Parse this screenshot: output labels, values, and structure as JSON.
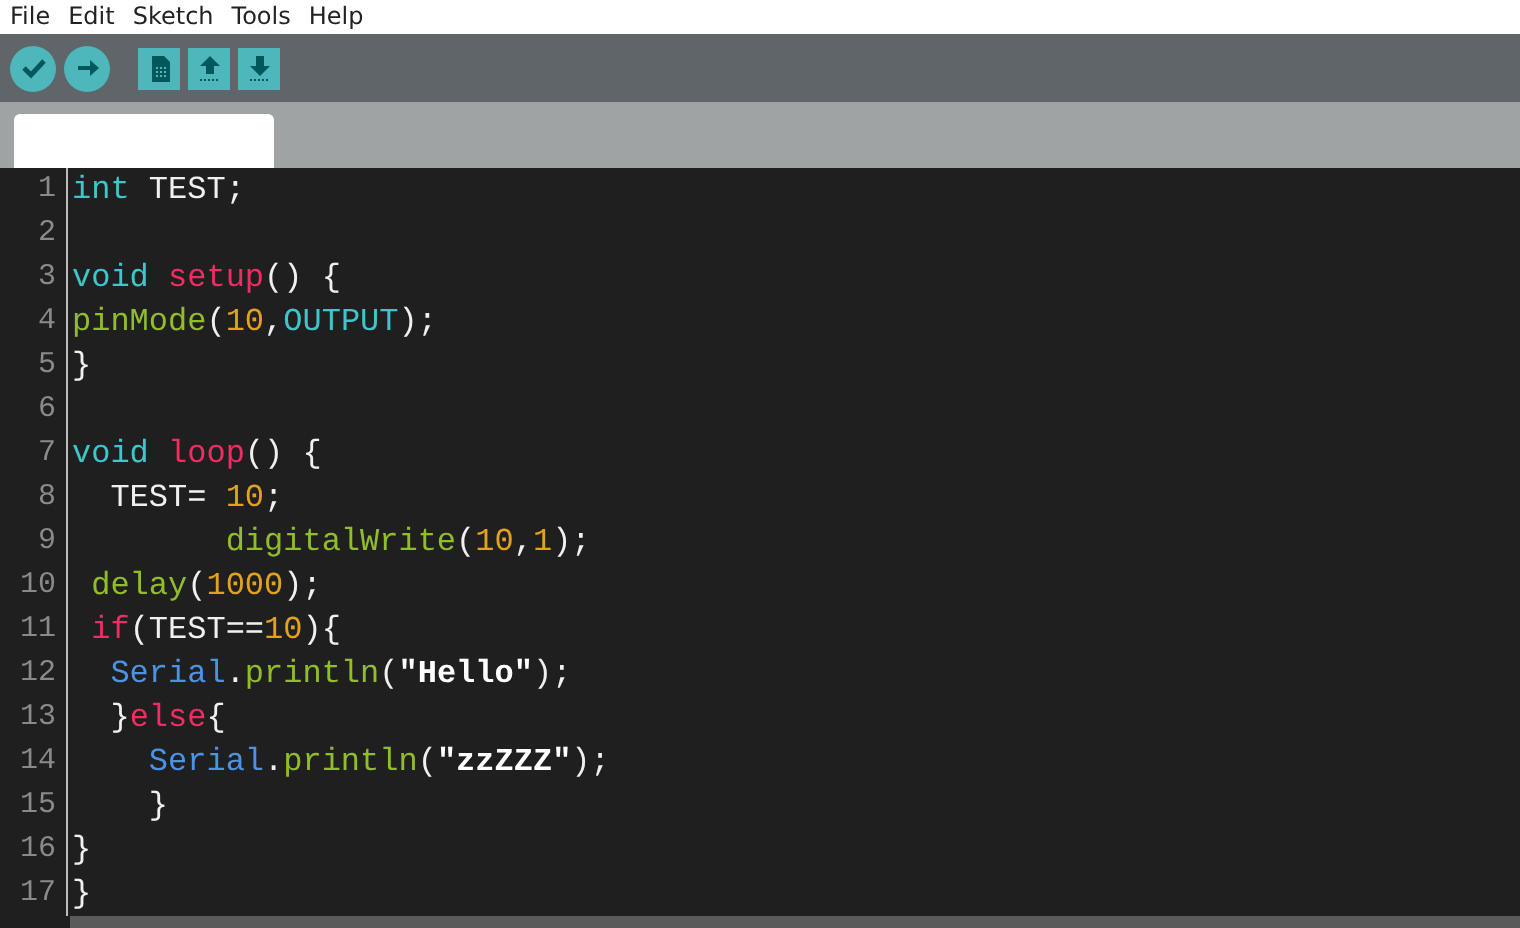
{
  "menu": [
    "File",
    "Edit",
    "Sketch",
    "Tools",
    "Help"
  ],
  "toolbar": [
    {
      "kind": "verify"
    },
    {
      "kind": "upload"
    },
    {
      "kind": "new"
    },
    {
      "kind": "open"
    },
    {
      "kind": "save"
    }
  ],
  "tabs": [
    {
      "selected": true
    }
  ],
  "editor": {
    "lines": [
      {
        "number": "1",
        "tokens": [
          {
            "kind": "type",
            "text": "int"
          },
          {
            "kind": "plain",
            "text": " TEST;"
          }
        ]
      },
      {
        "number": "2"
      },
      {
        "number": "3",
        "tokens": [
          {
            "kind": "type",
            "text": "void "
          },
          {
            "kind": "control",
            "text": "setup"
          },
          {
            "kind": "plain",
            "text": "() {"
          }
        ]
      },
      {
        "number": "4",
        "tokens": [
          {
            "kind": "function",
            "text": "pinMode"
          },
          {
            "kind": "plain",
            "text": "("
          },
          {
            "kind": "number",
            "text": "10"
          },
          {
            "kind": "plain",
            "text": ","
          },
          {
            "kind": "constant",
            "text": "OUTPUT"
          },
          {
            "kind": "plain",
            "text": ");"
          }
        ]
      },
      {
        "number": "5",
        "tokens": [
          {
            "kind": "plain",
            "text": "}"
          }
        ]
      },
      {
        "number": "6"
      },
      {
        "number": "7",
        "tokens": [
          {
            "kind": "type",
            "text": "void "
          },
          {
            "kind": "control",
            "text": "loop"
          },
          {
            "kind": "plain",
            "text": "() {"
          }
        ]
      },
      {
        "number": "8",
        "tokens": [
          {
            "kind": "plain",
            "text": "  TEST= "
          },
          {
            "kind": "number",
            "text": "10"
          },
          {
            "kind": "plain",
            "text": ";"
          }
        ]
      },
      {
        "number": "9",
        "tokens": [
          {
            "kind": "function",
            "text": "        digitalWrite"
          },
          {
            "kind": "plain",
            "text": "("
          },
          {
            "kind": "number",
            "text": "10"
          },
          {
            "kind": "plain",
            "text": ","
          },
          {
            "kind": "number",
            "text": "1"
          },
          {
            "kind": "plain",
            "text": ");"
          }
        ]
      },
      {
        "number": "10",
        "tokens": [
          {
            "kind": "function",
            "text": " delay"
          },
          {
            "kind": "plain",
            "text": "("
          },
          {
            "kind": "number",
            "text": "1000"
          },
          {
            "kind": "plain",
            "text": ");"
          }
        ]
      },
      {
        "number": "11",
        "tokens": [
          {
            "kind": "control",
            "text": " if"
          },
          {
            "kind": "plain",
            "text": "(TEST=="
          },
          {
            "kind": "number",
            "text": "10"
          },
          {
            "kind": "plain",
            "text": "){"
          }
        ]
      },
      {
        "number": "12",
        "tokens": [
          {
            "kind": "object",
            "text": "  Serial"
          },
          {
            "kind": "plain",
            "text": "."
          },
          {
            "kind": "function",
            "text": "println"
          },
          {
            "kind": "plain",
            "text": "("
          },
          {
            "kind": "string",
            "text": "\"Hello\""
          },
          {
            "kind": "plain",
            "text": ");"
          }
        ]
      },
      {
        "number": "13",
        "tokens": [
          {
            "kind": "plain",
            "text": "  }"
          },
          {
            "kind": "control",
            "text": "else"
          },
          {
            "kind": "plain",
            "text": "{"
          }
        ]
      },
      {
        "number": "14",
        "tokens": [
          {
            "kind": "object",
            "text": "    Serial"
          },
          {
            "kind": "plain",
            "text": "."
          },
          {
            "kind": "function",
            "text": "println"
          },
          {
            "kind": "plain",
            "text": "("
          },
          {
            "kind": "string",
            "text": "\"zzZZZ\""
          },
          {
            "kind": "plain",
            "text": ");"
          }
        ]
      },
      {
        "number": "15",
        "tokens": [
          {
            "kind": "plain",
            "text": "    }"
          }
        ]
      },
      {
        "number": "16",
        "tokens": [
          {
            "kind": "plain",
            "text": "}"
          }
        ]
      },
      {
        "number": "17",
        "tokens": [
          {
            "kind": "plain",
            "text": "}"
          }
        ]
      }
    ]
  }
}
